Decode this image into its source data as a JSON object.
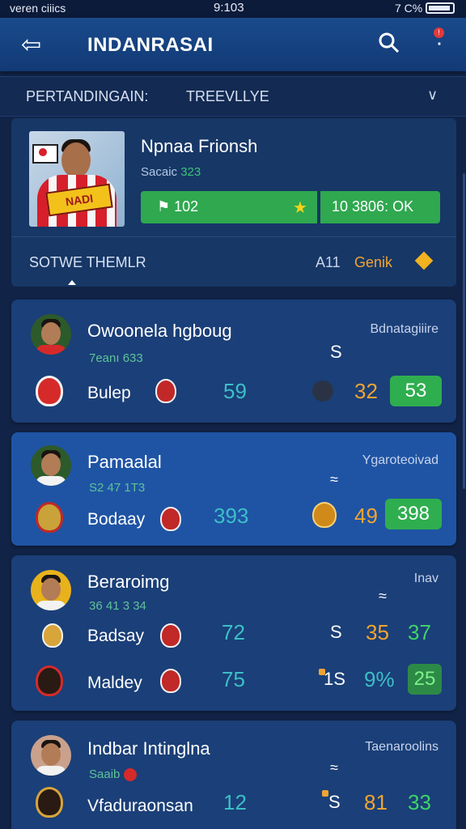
{
  "status": {
    "carrier": "veren ciiics",
    "time": "9:103",
    "battery": "7 C%"
  },
  "appbar": {
    "title": "INDANRASAI",
    "notif_badge": "!"
  },
  "filter": {
    "left": "PERTANDINGAIN:",
    "right": "TREEVLLYE"
  },
  "featured": {
    "photo_text": "NADI",
    "name": "Npnaa Frionsh",
    "subtitle_prefix": "Sacaic",
    "subtitle_value": "323",
    "score_left": "102",
    "score_right": "10  3806: OK",
    "section_label": "SOTWE THEMLR",
    "count": "A11",
    "genre": "Genik"
  },
  "cards": [
    {
      "player": "Owoonela hgboug",
      "sub": "7eanı 633",
      "right": "Bdnatagiiire",
      "mark": "S",
      "team": "Bulep",
      "val1": "59",
      "val2": "32",
      "pill": "53"
    },
    {
      "player": "Pamaalal",
      "sub": "S2 47 1T3",
      "right": "Ygaroteoivad",
      "mark": "≈",
      "team": "Bodaay",
      "val1": "393",
      "val2": "49",
      "pill": "398"
    },
    {
      "player": "Beraroimg",
      "sub": "36 41 3 34",
      "right": "Inav",
      "mark": "≈",
      "rows": [
        {
          "team": "Badsay",
          "val1": "72",
          "mark": "S",
          "val2": "35",
          "val3": "37"
        },
        {
          "team": "Maldey",
          "val1": "75",
          "mark": "1S",
          "val2": "9%",
          "pill": "25"
        }
      ]
    },
    {
      "player": "Indbar Intinglna",
      "sub": "Saaib",
      "right": "Taenaroolins",
      "mark": "≈",
      "team": "Vfaduraonsan",
      "val1": "12",
      "mark2": "S",
      "val2": "81",
      "val3": "33"
    }
  ]
}
